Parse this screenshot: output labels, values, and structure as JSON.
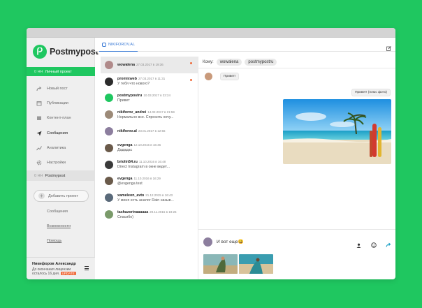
{
  "app": {
    "logo_text": "Postmypost"
  },
  "sidebar": {
    "active_project": {
      "prefix": "0 HH",
      "label": "Личный проект"
    },
    "nav": [
      {
        "label": "Новый пост",
        "icon": "share-icon"
      },
      {
        "label": "Публикации",
        "icon": "calendar-icon"
      },
      {
        "label": "Контент-план",
        "icon": "calendar-grid-icon"
      },
      {
        "label": "Сообщения",
        "icon": "send-icon"
      },
      {
        "label": "Аналитика",
        "icon": "chart-icon"
      },
      {
        "label": "Настройки",
        "icon": "gear-icon"
      }
    ],
    "second_project": {
      "prefix": "0 HH",
      "label": "Postmypost"
    },
    "add_project_label": "Добавить проект",
    "links": [
      "Сообщения",
      "Возможности",
      "Помощь"
    ],
    "user": {
      "name": "Никифоров Александр",
      "note_line1": "До окончания лицензии",
      "note_line2": "осталось 16 дня.",
      "update_label": "UPDATE"
    }
  },
  "tabs": {
    "account": "NIKIFOROV.AL"
  },
  "conversations": [
    {
      "name": "wowalena",
      "date": "27.03.2017 в 19:36",
      "msg": "",
      "unread": true,
      "avatar_color": "#b08a8a"
    },
    {
      "name": "promixweb",
      "date": "27.03.2017 в 11:31",
      "msg": "У тебя что нового?",
      "unread": true,
      "avatar_color": "#2c2c2c"
    },
    {
      "name": "postmypostru",
      "date": "10.03.2017 в 22:24",
      "msg": "Привет",
      "unread": false,
      "avatar_color": "#1fc760"
    },
    {
      "name": "nikiforov_andrei",
      "date": "14.02.2017 в 21:59",
      "msg": "Нормально все. Спросить хочу...",
      "unread": false,
      "avatar_color": "#9c8a78"
    },
    {
      "name": "nikiforov.al",
      "date": "23.01.2017 в 12:56",
      "msg": "",
      "unread": false,
      "avatar_color": "#8c7e9e"
    },
    {
      "name": "evgenga",
      "date": "12.10.2016 в 16:46",
      "msg": "Дададас",
      "unread": false,
      "avatar_color": "#6a5a4a"
    },
    {
      "name": "briolin54.ru",
      "date": "11.10.2016 в 16:48",
      "msg": "Direct Instagram в окне ведет...",
      "unread": false,
      "avatar_color": "#3a3a3a"
    },
    {
      "name": "evgenga",
      "date": "11.10.2016 в 16:29",
      "msg": "@evgenga test",
      "unread": false,
      "avatar_color": "#6a5a4a"
    },
    {
      "name": "xameleon_avto",
      "date": "21.12.2015 в 16:43",
      "msg": "У меня есть аналог Rain назыв...",
      "unread": false,
      "avatar_color": "#5a6a7a"
    },
    {
      "name": "tashazorinaaaaaa",
      "date": "29.11.2015 в 19:26",
      "msg": "Спасибо)",
      "unread": false,
      "avatar_color": "#7a9a6a"
    }
  ],
  "chat": {
    "to_label": "Кому:",
    "recipients": [
      "wowalena",
      "postmypostru"
    ],
    "incoming_message": "Привет!",
    "outgoing_message": "Привет! (плюс фото)",
    "compose_text": "И вот еще😀"
  },
  "colors": {
    "brand": "#1fc760",
    "accent": "#3a7ad5",
    "badge": "#ef6b3b"
  }
}
